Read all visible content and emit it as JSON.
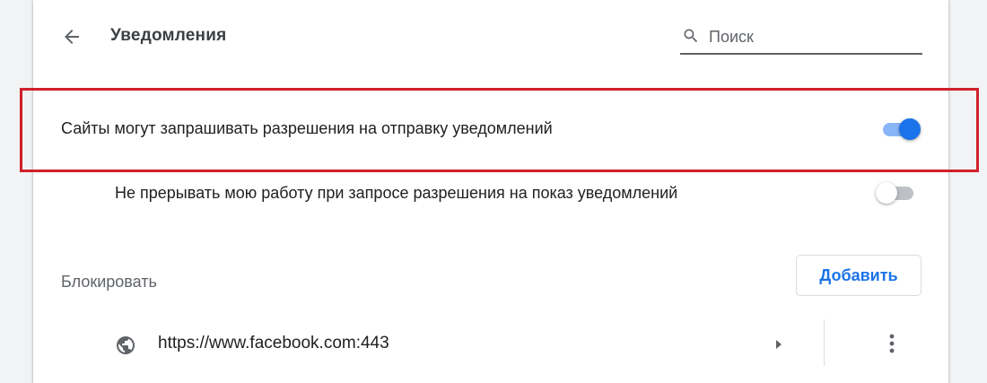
{
  "header": {
    "title": "Уведомления",
    "back_icon": "arrow-back-icon"
  },
  "search": {
    "placeholder": "Поиск",
    "value": "",
    "icon": "search-icon"
  },
  "settings": {
    "ask_permission": {
      "label": "Сайты могут запрашивать разрешения на отправку уведомлений",
      "enabled": true
    },
    "quiet_messaging": {
      "label": "Не прерывать мою работу при запросе разрешения на показ уведомлений",
      "enabled": false
    }
  },
  "block_section": {
    "title": "Блокировать",
    "add_label": "Добавить",
    "sites": [
      {
        "url": "https://www.facebook.com:443",
        "icon": "globe-icon"
      }
    ]
  },
  "colors": {
    "accent": "#1a73e8",
    "toggle_track_on": "#8ab4f8",
    "highlight_frame": "#d0202a"
  }
}
